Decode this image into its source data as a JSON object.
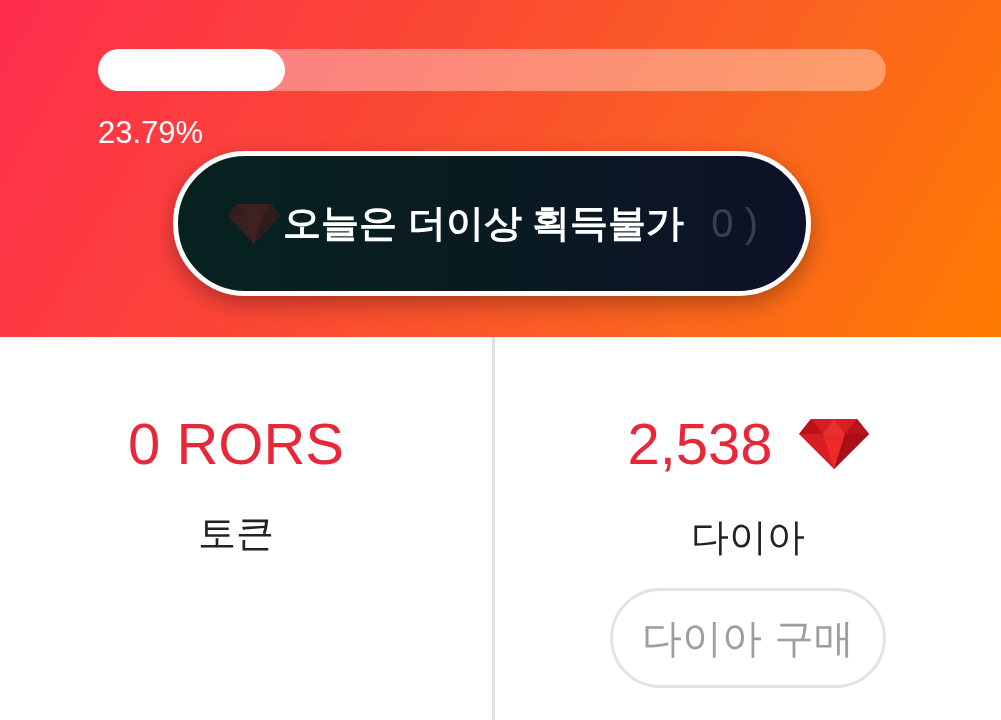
{
  "header": {
    "progress": {
      "level": 0.2379,
      "reading": "23.79%"
    },
    "claim_button": {
      "label": "0 )",
      "disabled": true
    },
    "toast": {
      "message": "오늘은 더이상 획득불가"
    }
  },
  "balances": [
    {
      "kind": "token",
      "amount": "0 RORS",
      "label": "토큰"
    },
    {
      "kind": "diamond",
      "amount": "2,538",
      "label": "다이아",
      "button": "다이아 구매"
    }
  ]
}
